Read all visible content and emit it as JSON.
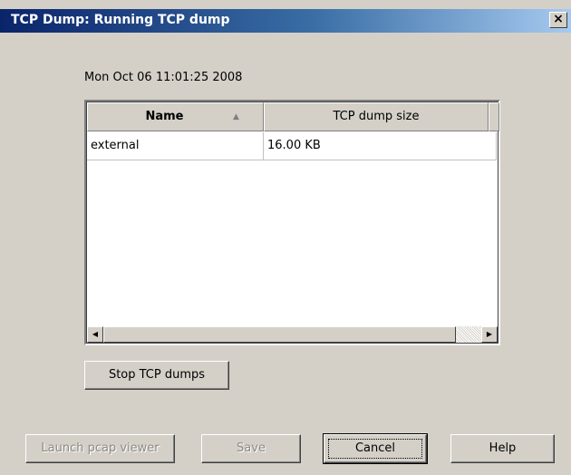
{
  "window": {
    "title": "TCP Dump: Running TCP dump",
    "close_label": "×"
  },
  "timestamp": "Mon Oct 06 11:01:25 2008",
  "table": {
    "columns": [
      "Name",
      "TCP dump size"
    ],
    "sort_indicator": "▲",
    "rows": [
      {
        "name": "external",
        "size": "16.00 KB"
      }
    ]
  },
  "scrollbar": {
    "left_arrow": "◀",
    "right_arrow": "▶"
  },
  "buttons": {
    "stop": "Stop TCP dumps",
    "launch_viewer": "Launch pcap viewer",
    "save": "Save",
    "cancel": "Cancel",
    "help": "Help"
  }
}
